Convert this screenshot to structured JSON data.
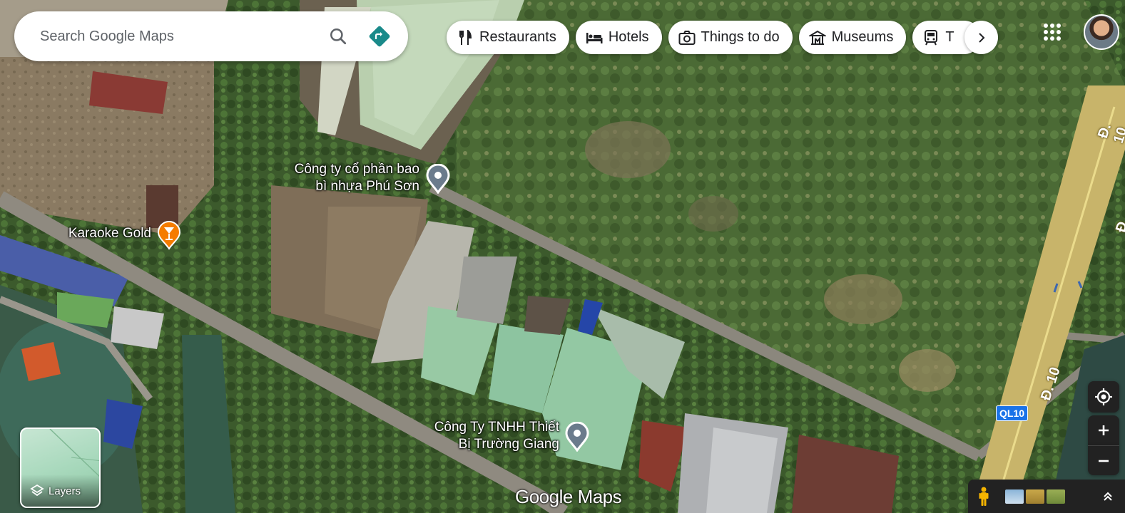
{
  "search": {
    "placeholder": "Search Google Maps"
  },
  "chips": [
    {
      "label": "Restaurants",
      "icon": "fork-knife-icon"
    },
    {
      "label": "Hotels",
      "icon": "bed-icon"
    },
    {
      "label": "Things to do",
      "icon": "camera-icon"
    },
    {
      "label": "Museums",
      "icon": "museum-icon"
    },
    {
      "label": "T",
      "icon": "train-icon"
    }
  ],
  "places": [
    {
      "name_line1": "Công ty cổ phần bao",
      "name_line2": "bì nhựa Phú Sơn"
    },
    {
      "name_line1": "Karaoke Gold",
      "name_line2": ""
    },
    {
      "name_line1": "Công Ty TNHH Thiết",
      "name_line2": "Bị Trường Giang"
    }
  ],
  "roads": {
    "label_top": "Đ. 10",
    "label_bottom": "Đ. 10",
    "label_right_partial": "Đ",
    "shield": "QL10"
  },
  "layers": {
    "label": "Layers"
  },
  "watermark": "Google Maps",
  "colors": {
    "accent_directions": "#1a73e8",
    "karaoke_pin": "#f57c00",
    "shield": "#1a73e8"
  }
}
